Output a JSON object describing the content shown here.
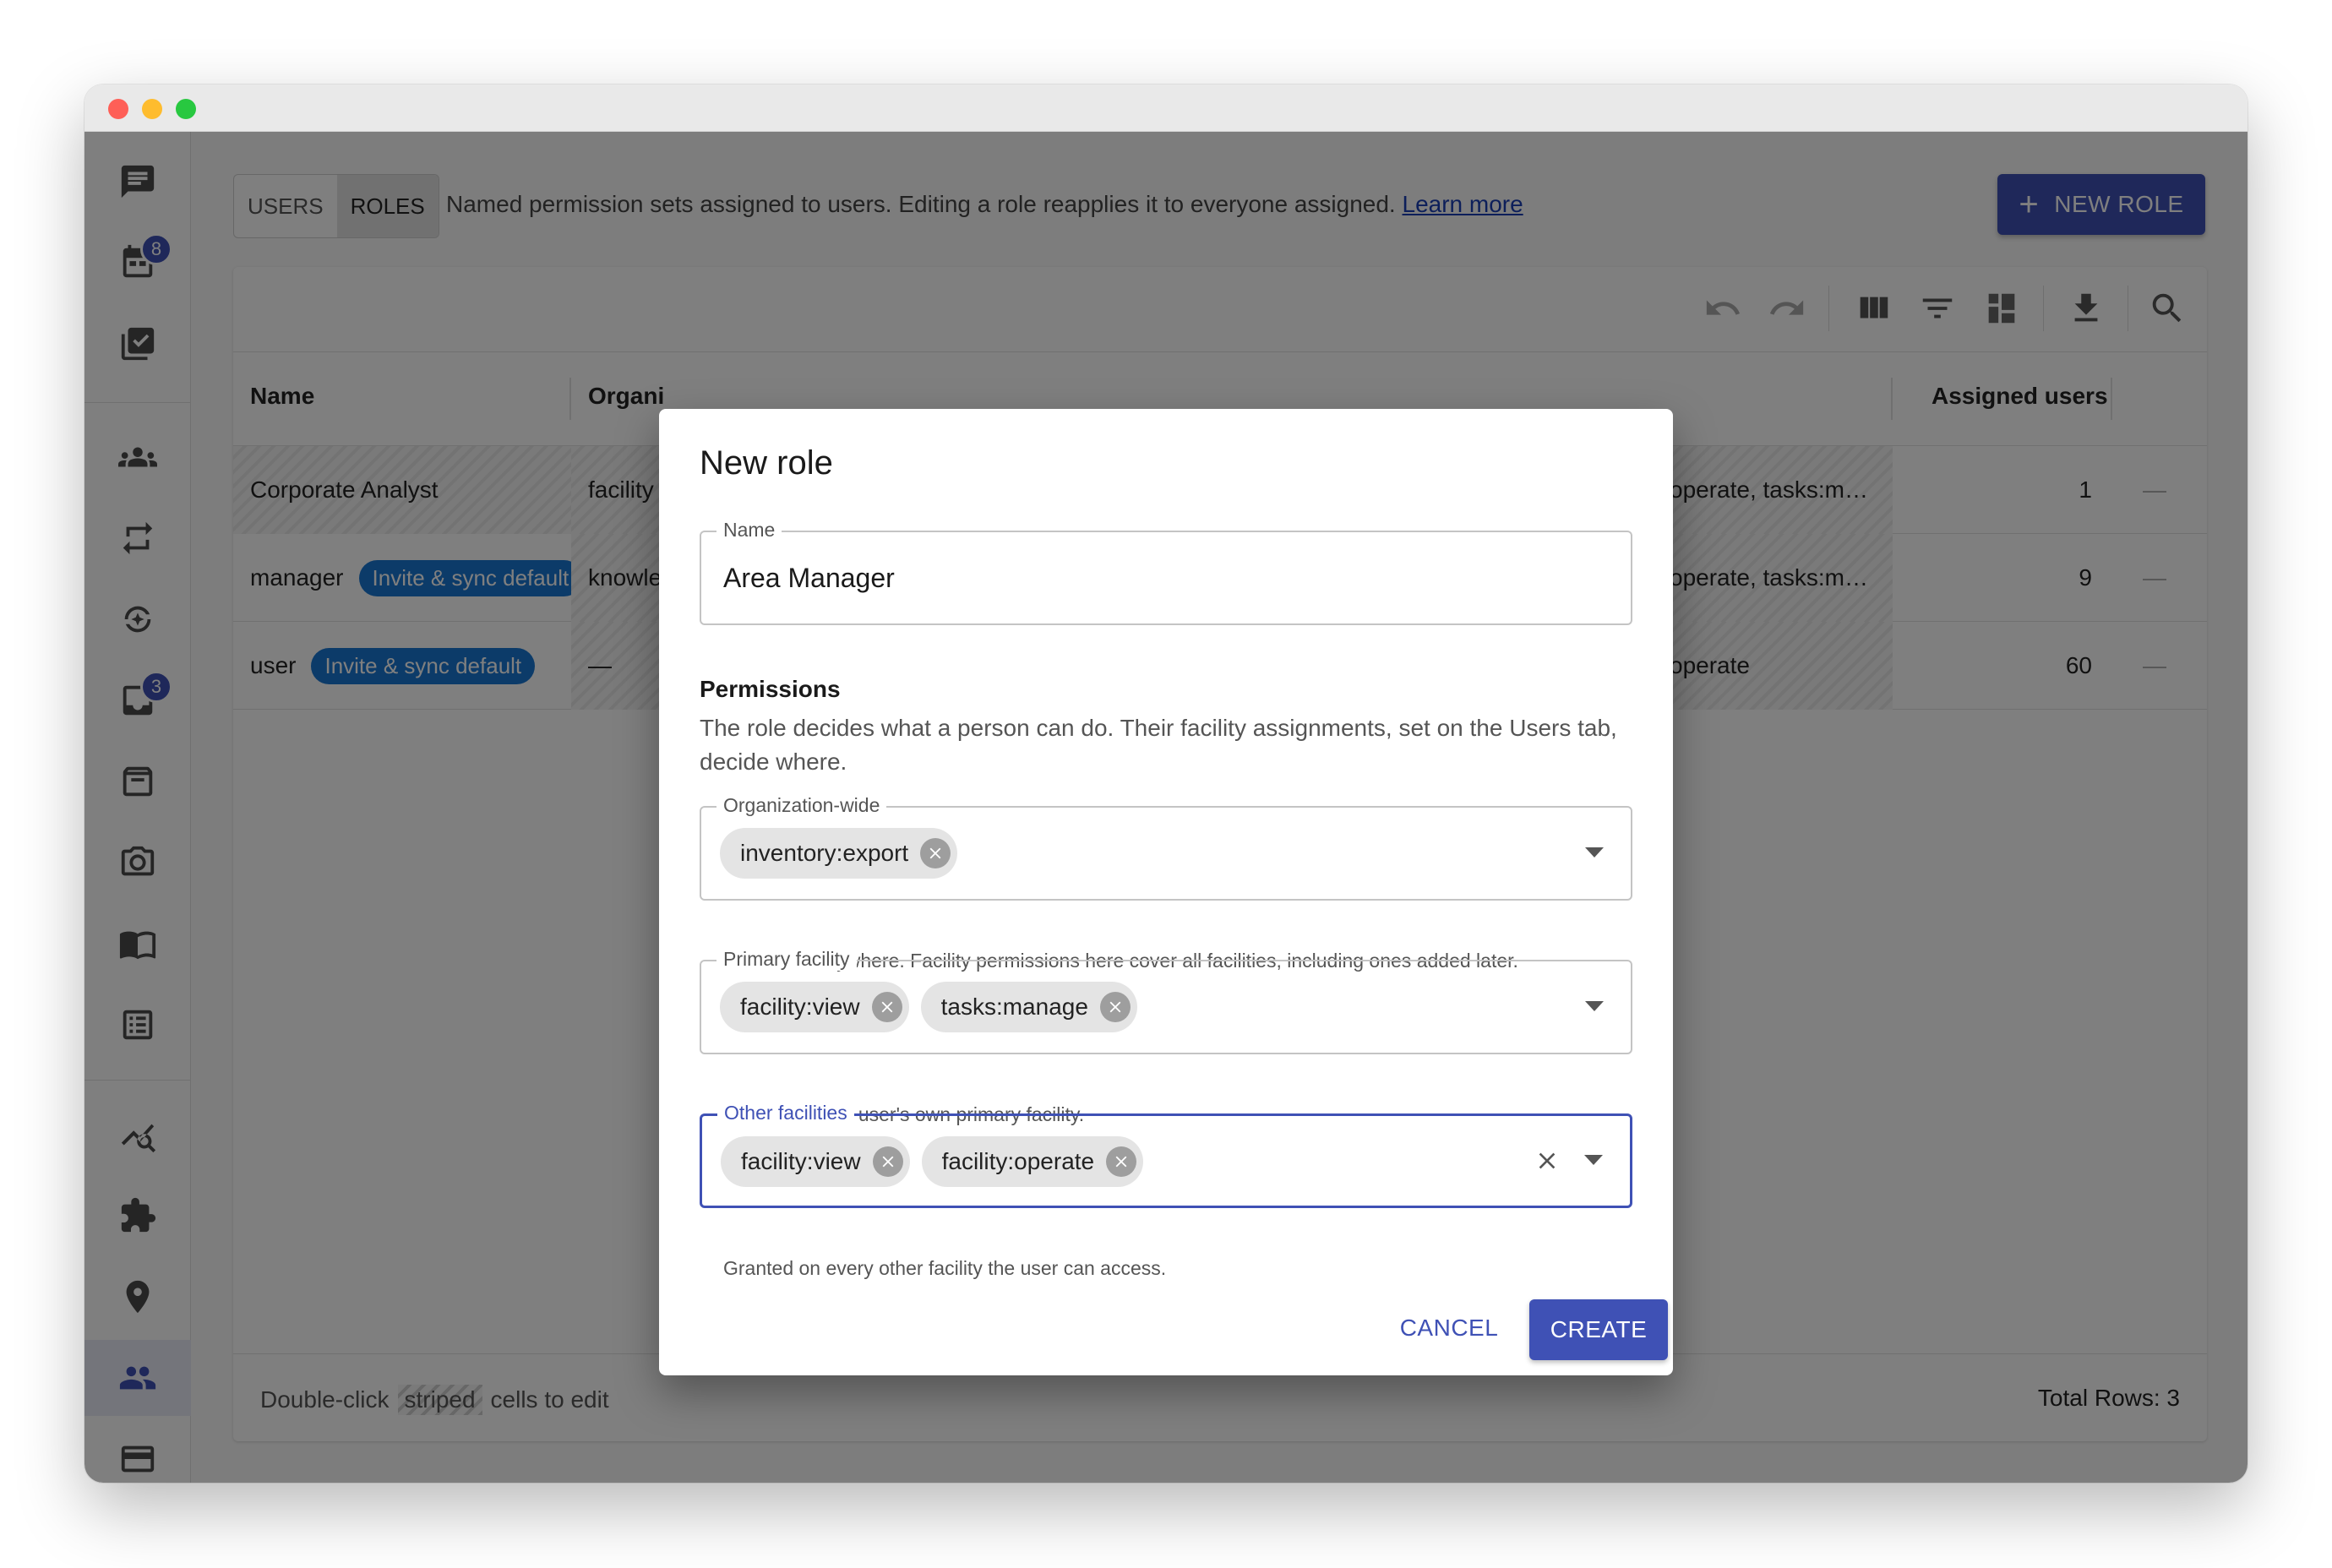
{
  "sidebar": {
    "badges": {
      "calendar": "8",
      "inbox": "3"
    }
  },
  "toolbar": {
    "tab_users": "USERS",
    "tab_roles": "ROLES",
    "description": "Named permission sets assigned to users. Editing a role reapplies it to everyone assigned.",
    "learn_more": "Learn more",
    "new_role": "NEW ROLE"
  },
  "grid": {
    "columns": {
      "name": "Name",
      "organization": "Organi",
      "assigned_users": "Assigned users"
    },
    "rows": [
      {
        "name": "Corporate Analyst",
        "badge": "",
        "org": "facility",
        "other": "operate, tasks:m…",
        "assigned": "1",
        "action": "—"
      },
      {
        "name": "manager",
        "badge": "Invite & sync default",
        "org": "knowle",
        "other": "operate, tasks:m…",
        "assigned": "9",
        "action": "—"
      },
      {
        "name": "user",
        "badge": "Invite & sync default",
        "org": "—",
        "other": "operate",
        "assigned": "60",
        "action": "—"
      }
    ],
    "footer_prefix": "Double-click",
    "footer_striped": "striped",
    "footer_suffix": "cells to edit",
    "total_rows": "Total Rows: 3"
  },
  "dialog": {
    "title": "New role",
    "name_label": "Name",
    "name_value": "Area Manager",
    "permissions_title": "Permissions",
    "permissions_desc": "The role decides what a person can do. Their facility assignments, set on the Users tab, decide where.",
    "org_wide": {
      "label": "Organization-wide",
      "chips": [
        "inventory:export"
      ],
      "helper": "Granted everywhere. Facility permissions here cover all facilities, including ones added later."
    },
    "primary": {
      "label": "Primary facility",
      "chips": [
        "facility:view",
        "tasks:manage"
      ],
      "helper": "Granted on the user's own primary facility."
    },
    "other": {
      "label": "Other facilities",
      "chips": [
        "facility:view",
        "facility:operate"
      ],
      "helper": "Granted on every other facility the user can access."
    },
    "cancel": "CANCEL",
    "create": "CREATE"
  },
  "colors": {
    "accent": "#3f51b5",
    "chip_blue": "#1976d2"
  }
}
